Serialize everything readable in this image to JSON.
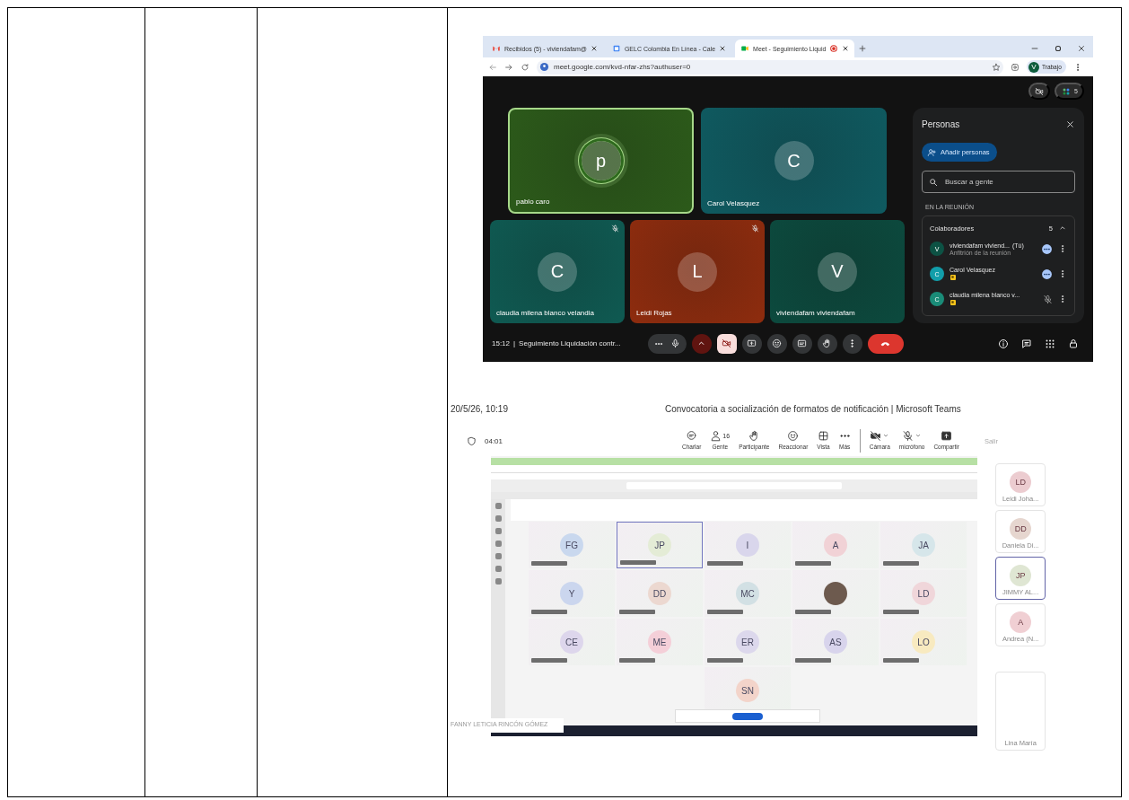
{
  "meet_window": {
    "tabs": [
      {
        "kind": "mail",
        "title": "Recibidos (5) - viviendafam@",
        "selected": false,
        "recording": false
      },
      {
        "kind": "calendar",
        "title": "GELC Colombia En Línea - Cale",
        "selected": false,
        "recording": false
      },
      {
        "kind": "meet",
        "title": "Meet - Seguimiento Liquid",
        "selected": true,
        "recording": true
      }
    ],
    "address": "meet.google.com/kvd-nfar-zhs?authuser=0",
    "profile": {
      "initial": "V",
      "label": "Trabajo"
    },
    "participant_count": "5",
    "tiles": [
      {
        "name": "pablo caro",
        "initial": "p",
        "color": "#2c5a1a",
        "speaking": true,
        "muted": false
      },
      {
        "name": "Carol Velasquez",
        "initial": "C",
        "color": "#0f5a60",
        "speaking": false,
        "muted": false
      },
      {
        "name": "claudia milena blanco velandia",
        "initial": "C",
        "color": "#0f5a52",
        "speaking": false,
        "muted": true
      },
      {
        "name": "Leidi Rojas",
        "initial": "L",
        "color": "#8e2c0e",
        "speaking": false,
        "muted": true
      },
      {
        "name": "viviendafam viviendafam",
        "initial": "V",
        "color": "#0c4a3e",
        "speaking": false,
        "muted": false
      }
    ],
    "people_panel": {
      "title": "Personas",
      "add_button": "Añadir personas",
      "search_placeholder": "Buscar a gente",
      "section": "EN LA REUNIÓN",
      "group": {
        "name": "Colaboradores",
        "count": "5",
        "expanded": true
      },
      "members": [
        {
          "name": "viviendafam viviend...",
          "you_label": "(Tú)",
          "role": "Anfitrión de la reunión",
          "initial": "V",
          "color": "#0d5244",
          "speaking": true,
          "muted": false,
          "badge": false
        },
        {
          "name": "Carol Velasquez",
          "initial": "C",
          "color": "#129eaa",
          "speaking": true,
          "muted": false,
          "badge": true
        },
        {
          "name": "claudia milena blanco v...",
          "initial": "C",
          "color": "#1a8c78",
          "speaking": false,
          "muted": true,
          "badge": true
        }
      ]
    },
    "call_bar": {
      "time": "15:12",
      "separator": "|",
      "title": "Seguimiento Liquidación contr...",
      "camera_off": true
    }
  },
  "teams_window": {
    "timestamp": "20/5/26, 10:19",
    "title": "Convocatoria a socialización de formatos de notificación | Microsoft Teams",
    "timer": "04:01",
    "toolbar": [
      {
        "kind": "chat",
        "label": "Charlar"
      },
      {
        "kind": "people",
        "label": "Gente",
        "count": "16"
      },
      {
        "kind": "hand",
        "label": "Participante"
      },
      {
        "kind": "react",
        "label": "Reaccionar"
      },
      {
        "kind": "view",
        "label": "Vista"
      },
      {
        "kind": "more",
        "label": "Más"
      },
      {
        "kind": "camera",
        "label": "Cámara"
      },
      {
        "kind": "mic",
        "label": "micrófono"
      },
      {
        "kind": "share",
        "label": "Compartir"
      }
    ],
    "leave": "Salir",
    "shared_screen": {
      "presenter": "FANNY LETICIA RINCÓN GÓMEZ",
      "tiles": [
        {
          "kind": "avatar",
          "initials": "FG",
          "color": "#c9d8ee",
          "selected": false
        },
        {
          "kind": "avatar",
          "initials": "JP",
          "color": "#e4ecd6",
          "selected": true
        },
        {
          "kind": "avatar",
          "initials": "I",
          "color": "#d9d6ec",
          "selected": false
        },
        {
          "kind": "avatar",
          "initials": "A",
          "color": "#f1d2d6",
          "selected": false
        },
        {
          "kind": "avatar",
          "initials": "JA",
          "color": "#d6e6ea",
          "selected": false
        },
        {
          "kind": "avatar",
          "initials": "Y",
          "color": "#cbd6ee",
          "selected": false
        },
        {
          "kind": "avatar",
          "initials": "DD",
          "color": "#ecd8d0",
          "selected": false
        },
        {
          "kind": "avatar",
          "initials": "MC",
          "color": "#d2e0e4",
          "selected": false
        },
        {
          "kind": "photo",
          "selected": false
        },
        {
          "kind": "avatar",
          "initials": "LD",
          "color": "#f0d6da",
          "selected": false
        },
        {
          "kind": "avatar",
          "initials": "CE",
          "color": "#ddd6ec",
          "selected": false
        },
        {
          "kind": "avatar",
          "initials": "ME",
          "color": "#f4cfd8",
          "selected": false
        },
        {
          "kind": "avatar",
          "initials": "ER",
          "color": "#dcd8ec",
          "selected": false
        },
        {
          "kind": "avatar",
          "initials": "AS",
          "color": "#d8d4ec",
          "selected": false
        },
        {
          "kind": "avatar",
          "initials": "LO",
          "color": "#f8eac0",
          "selected": false
        },
        {
          "kind": "avatar",
          "initials": "SN",
          "color": "#f3d4ca",
          "selected": false
        }
      ]
    },
    "side_tiles": [
      {
        "kind": "avatar",
        "initials": "LD",
        "name": "Leidi Joha...",
        "color": "#ecccd0",
        "selected": false
      },
      {
        "kind": "avatar",
        "initials": "DD",
        "name": "Daniela Di...",
        "color": "#e6d6cf",
        "selected": false
      },
      {
        "kind": "avatar",
        "initials": "JP",
        "name": "JIMMY AL...",
        "color": "#dfe6d3",
        "selected": true
      },
      {
        "kind": "avatar",
        "initials": "A",
        "name": "Andrea (N...",
        "color": "#f0cfd3",
        "selected": false
      },
      {
        "kind": "blank",
        "name": "Lina María",
        "selected": false
      }
    ]
  }
}
